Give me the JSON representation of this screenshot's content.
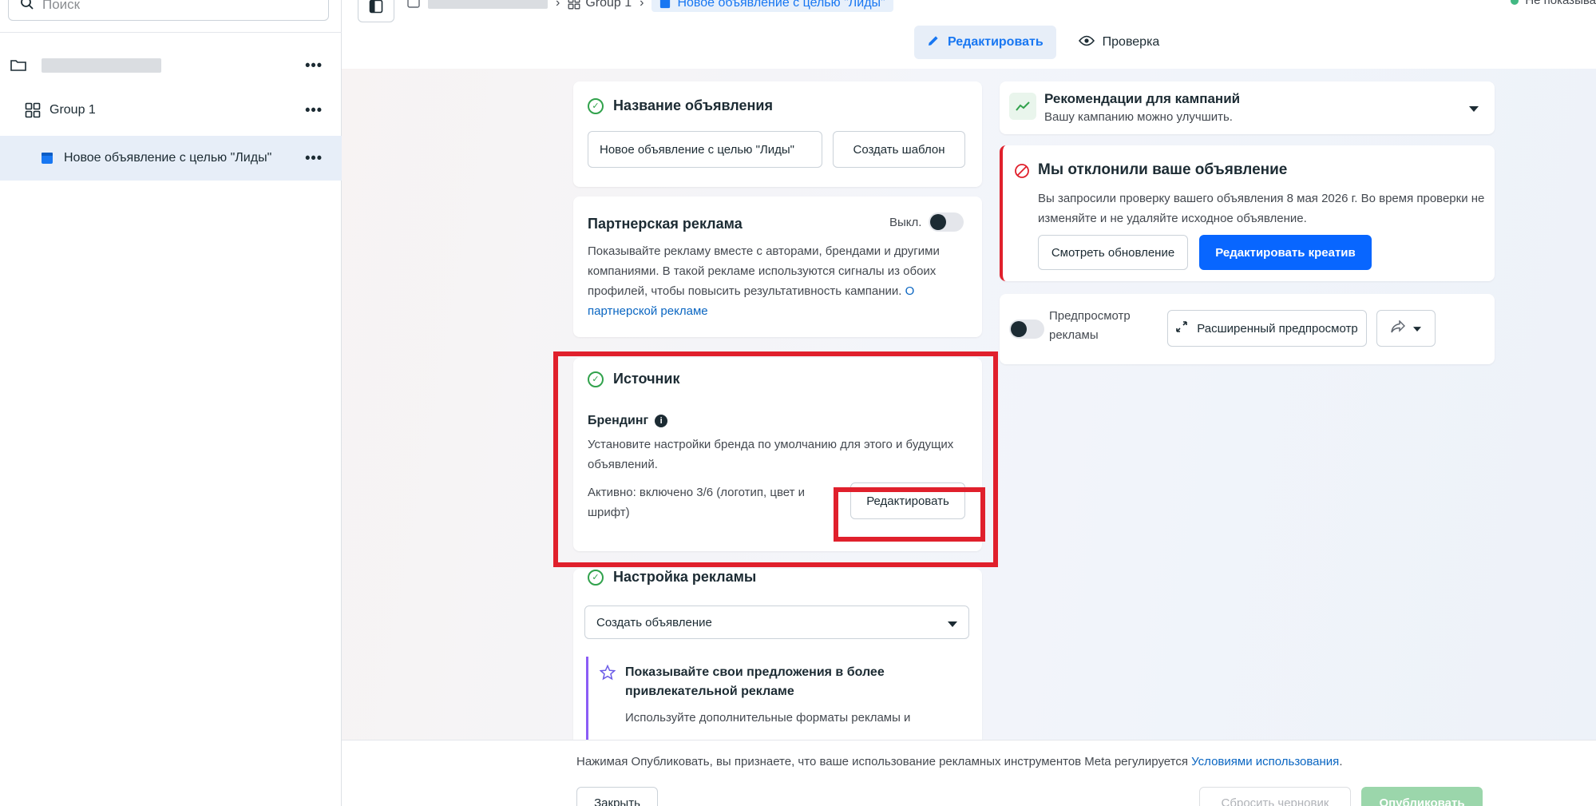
{
  "sidebar": {
    "search_placeholder": "Поиск",
    "items": [
      {
        "type": "campaign",
        "label": ""
      },
      {
        "type": "group",
        "label": "Group 1"
      },
      {
        "type": "ad",
        "label": "Новое объявление с целью \"Лиды\""
      }
    ]
  },
  "topbar": {
    "breadcrumb_group": "Group 1",
    "breadcrumb_ad": "Новое объявление с целью \"Лиды\"",
    "status": "Не показыва",
    "tab_edit": "Редактировать",
    "tab_review": "Проверка"
  },
  "ad_name": {
    "title": "Название объявления",
    "value": "Новое объявление с целью \"Лиды\"",
    "template_button": "Создать шаблон"
  },
  "partner": {
    "title": "Партнерская реклама",
    "toggle_label": "Выкл.",
    "description": "Показывайте рекламу вместе с авторами, брендами и другими компаниями. В такой рекламе используются сигналы из обоих профилей, чтобы повысить результативность кампании.",
    "link": "О партнерской рекламе"
  },
  "source": {
    "title": "Источник",
    "branding_title": "Брендинг",
    "branding_desc": "Установите настройки бренда по умолчанию для этого и будущих объявлений.",
    "active_status": "Активно: включено 3/6 (логотип, цвет и шрифт)",
    "edit_button": "Редактировать"
  },
  "ad_setup": {
    "title": "Настройка рекламы",
    "select_value": "Создать объявление",
    "promo_title": "Показывайте свои предложения в более привлекательной рекламе",
    "promo_desc": "Используйте дополнительные форматы рекламы и"
  },
  "recommendations": {
    "title": "Рекомендации для кампаний",
    "subtitle": "Вашу кампанию можно улучшить."
  },
  "rejected": {
    "title": "Мы отклонили ваше объявление",
    "description": "Вы запросили проверку вашего объявления 8 мая 2026 г. Во время проверки не изменяйте и не удаляйте исходное объявление.",
    "view_update_button": "Смотреть обновление",
    "edit_creative_button": "Редактировать креатив"
  },
  "preview": {
    "label": "Предпросмотр рекламы",
    "expanded_button": "Расширенный предпросмотр"
  },
  "footer": {
    "note_prefix": "Нажимая Опубликовать, вы признаете, что ваше использование рекламных инструментов Meta регулируется ",
    "note_link": "Условиями использования",
    "note_suffix": ".",
    "close_button": "Закрыть",
    "reset_button": "Сбросить черновик",
    "publish_button": "Опубликовать"
  },
  "colors": {
    "accent": "#0866ff",
    "success": "#31a24c",
    "error": "#e0202c",
    "highlight": "#e0202c"
  }
}
